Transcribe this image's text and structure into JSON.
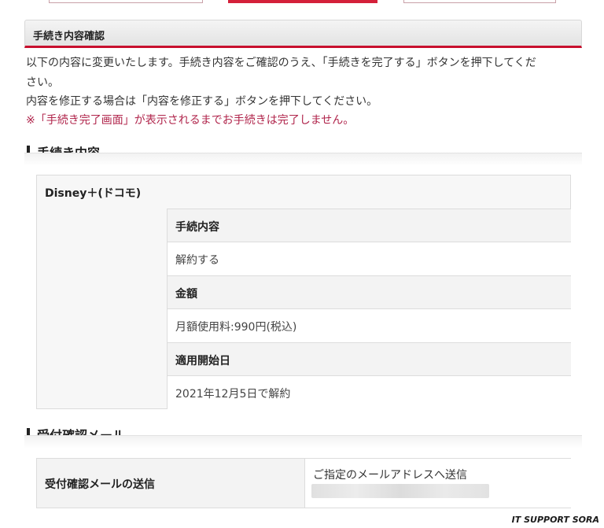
{
  "confirm_header": "手続き内容確認",
  "messages": {
    "line1": "以下の内容に変更いたします。手続き内容をご確認のうえ、「手続きを完了する」ボタンを押下してくだ",
    "line2": "さい。",
    "line3": "内容を修正する場合は「内容を修正する」ボタンを押下してください。",
    "notice": "※「手続き完了画面」が表示されるまでお手続きは完了しません。"
  },
  "procedure_section": {
    "title": "手続き内容",
    "service_name": "Disney＋(ドコモ)",
    "rows": [
      {
        "label": "手続内容",
        "value": "解約する"
      },
      {
        "label": "金額",
        "value": "月額使用料:990円(税込)"
      },
      {
        "label": "適用開始日",
        "value": "2021年12月5日で解約"
      }
    ]
  },
  "mail_section": {
    "title": "受付確認メール",
    "label": "受付確認メールの送信",
    "value": "ご指定のメールアドレスへ送信"
  },
  "watermark": "IT SUPPORT SORA",
  "colors": {
    "accent": "#c8102e",
    "notice": "#b0244b"
  }
}
